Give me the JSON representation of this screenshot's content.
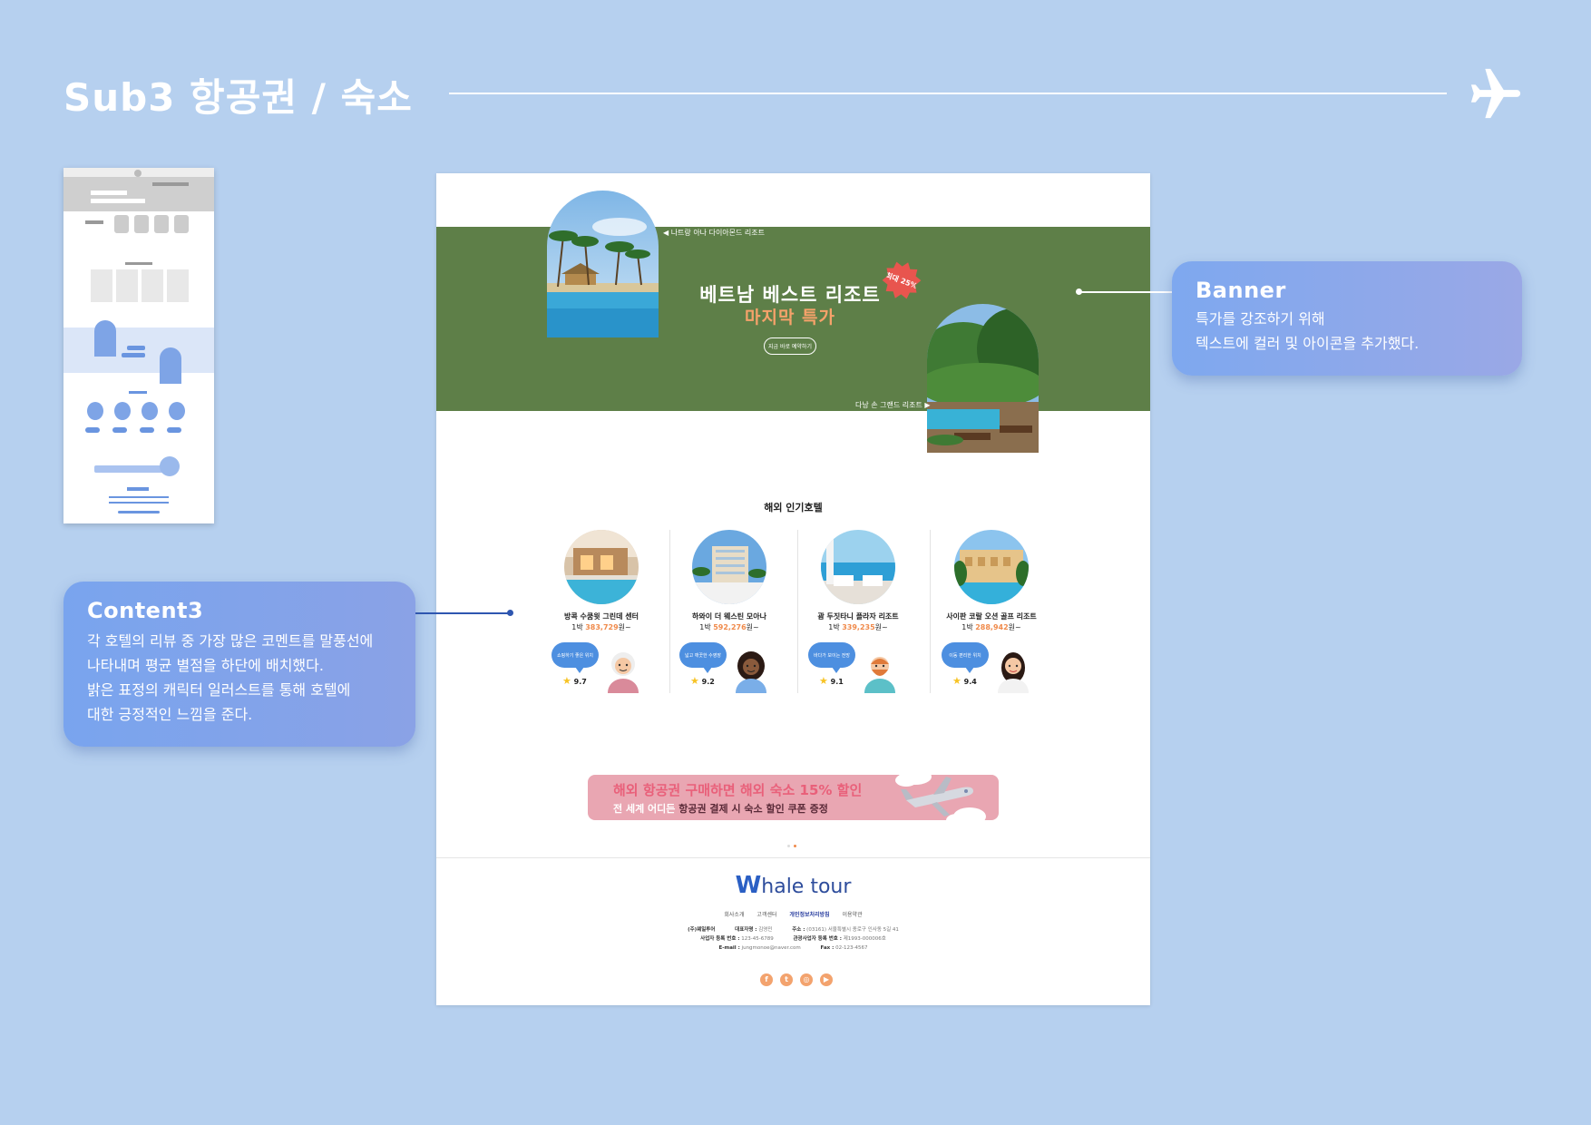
{
  "header": {
    "title": "Sub3 항공권 / 숙소"
  },
  "banner": {
    "title": "베트남 베스트 리조트",
    "subtitle": "마지막 특가",
    "badge": "최대 25%",
    "cta": "지금 바로 예약하기",
    "resort_1": "◀ 나트랑 아나 다이아몬드 리조트",
    "resort_2": "다낭 손 그랜드 리조트 ▶"
  },
  "hotels_section": {
    "title": "해외 인기호텔",
    "items": [
      {
        "name": "방콕 수쿰윗 그린데 센터",
        "price_prefix": "1박 ",
        "price": "383,729",
        "price_suffix": "원~",
        "review": "쇼핑하기 좋은 위치",
        "rating": "9.7"
      },
      {
        "name": "하와이 더 웨스틴 모아나",
        "price_prefix": "1박 ",
        "price": "592,276",
        "price_suffix": "원~",
        "review": "넓고 깨끗한 수영장",
        "rating": "9.2"
      },
      {
        "name": "괌 두짓타니 플라자 리조트",
        "price_prefix": "1박 ",
        "price": "339,235",
        "price_suffix": "원~",
        "review": "바다가 보이는 전망",
        "rating": "9.1"
      },
      {
        "name": "사이판 코랄 오션 골프 리조트",
        "price_prefix": "1박 ",
        "price": "288,942",
        "price_suffix": "원~",
        "review": "이동 편리한 위치",
        "rating": "9.4"
      }
    ]
  },
  "promo": {
    "line1": "해외 항공권 구매하면 해외 숙소 15% 할인",
    "line2_pre": "전 세계 어디든 ",
    "line2_hl": "항공권 결제 시 숙소 할인 쿠폰 증정"
  },
  "footer": {
    "logo_w": "W",
    "logo_rest": "hale tour",
    "links": [
      "회사소개",
      "고객센터",
      "개인정보처리방침",
      "이용약관"
    ],
    "info_1a_label": "(주)웨일투어",
    "info_1b_label": "대표자명 :",
    "info_1b_value": " 김영민",
    "info_1c_label": "주소 :",
    "info_1c_value": " (03161) 서울특별시 종로구 인사동 5길 41",
    "info_2a_label": "사업자 등록 번호 :",
    "info_2a_value": " 123-45-6789",
    "info_2b_label": "관광사업자 등록 번호 :",
    "info_2b_value": " 제1993-000006호",
    "info_3a_label": "E-mail :",
    "info_3a_value": " jungmonoe@naver.com",
    "info_3b_label": "Fax :",
    "info_3b_value": " 02-123-4567"
  },
  "annotations": {
    "banner_title": "Banner",
    "banner_line1": "특가를 강조하기 위해",
    "banner_line2": "텍스트에 컬러 및 아이콘을 추가했다.",
    "content_title": "Content3",
    "content_line1": "각 호텔의 리뷰 중 가장 많은 코멘트를 말풍선에",
    "content_line2": "나타내며 평균 별점을 하단에 배치했다.",
    "content_line3": "밝은 표정의 캐릭터 일러스트를 통해 호텔에",
    "content_line4": "대한 긍정적인 느낌을 준다."
  },
  "colors": {
    "background": "#b6d0ef",
    "banner_green": "#5e7f48",
    "accent_orange": "#f08a4b",
    "speech_blue": "#4d8fe0",
    "promo_pink": "#e9a6b2",
    "logo_blue": "#2a5fc4"
  },
  "icons": [
    "airplane-icon",
    "star-icon",
    "facebook-icon",
    "twitter-icon",
    "instagram-icon",
    "youtube-icon"
  ]
}
